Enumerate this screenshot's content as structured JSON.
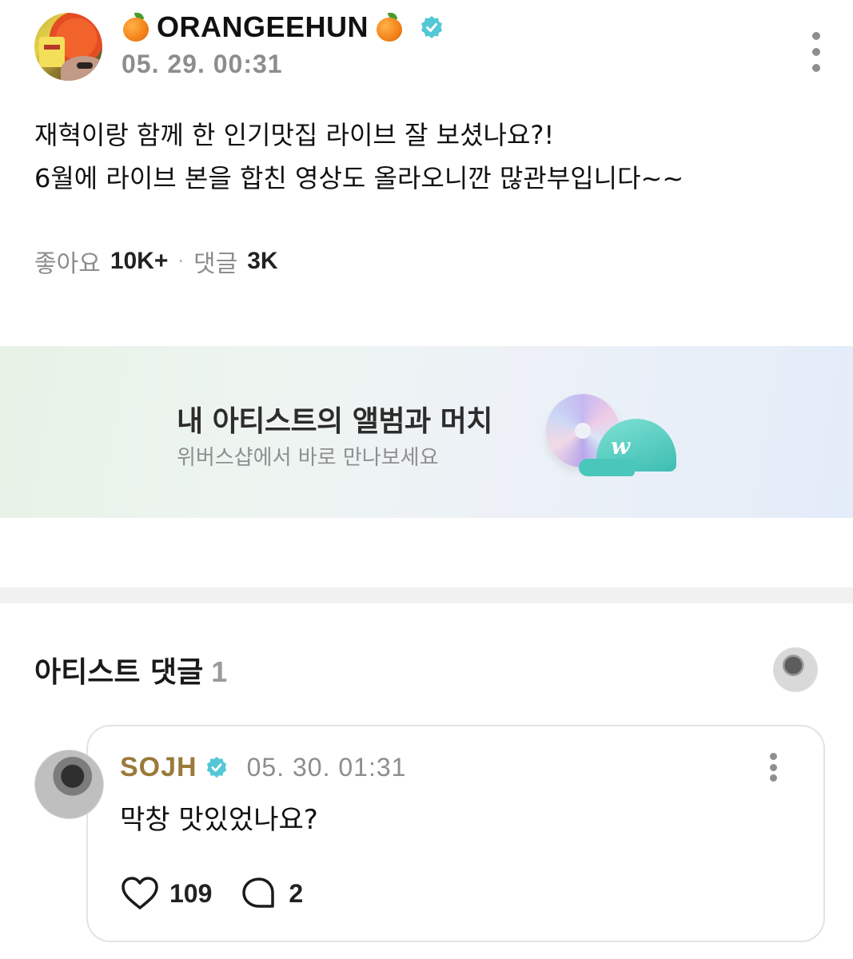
{
  "post": {
    "author": {
      "display_name": "ORANGEEHUN",
      "verified": true
    },
    "timestamp": "05. 29. 00:31",
    "body_lines": [
      "재혁이랑 함께 한 인기맛집 라이브 잘 보셨나요?!",
      "6월에 라이브 본을 합친 영상도 올라오니깐 많관부입니다~~"
    ],
    "stats": {
      "likes_label": "좋아요",
      "likes_value": "10K+",
      "separator": "·",
      "comments_label": "댓글",
      "comments_value": "3K"
    }
  },
  "banner": {
    "title": "내 아티스트의 앨범과 머치",
    "subtitle": "위버스샵에서 바로 만나보세요",
    "cap_logo": "w"
  },
  "artist_comments": {
    "title": "아티스트 댓글",
    "count": "1",
    "items": [
      {
        "author": "SOJH",
        "verified": true,
        "timestamp": "05. 30. 01:31",
        "text": "막창 맛있었나요?",
        "likes": "109",
        "replies": "2"
      }
    ]
  },
  "colors": {
    "verified_badge": "#53c7d6",
    "commenter_name": "#9a7a3a",
    "muted_text": "#8d8d8d",
    "divider": "#f1f1f1"
  },
  "icons": {
    "more": "more-vertical-icon",
    "verified": "verified-badge-icon",
    "like": "heart-icon",
    "reply": "speech-bubble-icon"
  }
}
